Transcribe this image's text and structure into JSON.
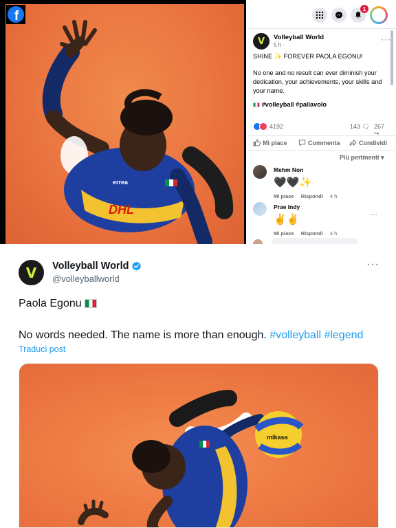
{
  "facebook": {
    "logo_letter": "f",
    "topbar": {
      "icons": [
        "apps-grid-icon",
        "messenger-icon",
        "bell-icon",
        "profile-avatar"
      ],
      "notification_count": "1"
    },
    "post": {
      "author": "Volleyball World",
      "time": "5 h ·",
      "avatar_mark": "V",
      "line1": "SHINE ✨ FOREVER PAOLA EGONU!",
      "body": "No one and no result can ever diminish your dedication, your achievements, your skills and your name.",
      "tags": "#volleyball #pallavolo",
      "reactions_count": "4192",
      "comments_count": "143",
      "shares_count": "267",
      "actions": {
        "like": "Mi piace",
        "comment": "Commenta",
        "share": "Condividi"
      },
      "sort_label": "Più pertinenti ▾"
    },
    "comments": [
      {
        "name": "Mehm Non",
        "emoji": "🖤🖤✨",
        "like": "Mi piace",
        "reply": "Rispondi",
        "time": "4 h"
      },
      {
        "name": "Prae Indy",
        "emoji": "✌️✌️",
        "like": "Mi piace",
        "reply": "Rispondi",
        "time": "4 h"
      }
    ]
  },
  "twitter": {
    "author": "Volleyball World",
    "handle": "@volleyballworld",
    "avatar_mark": "V",
    "line1": "Paola Egonu",
    "line2_text": "No words needed. The name is more than enough.",
    "line2_tag1": "#volleyball",
    "line2_tag2": "#legend",
    "translate": "Traduci post"
  },
  "colors": {
    "facebook_blue": "#1877f2",
    "twitter_blue": "#1d9bf0",
    "photo_orange": "#ea7440",
    "jersey_blue": "#1f3fa0",
    "brand_green": "#c6f13d"
  }
}
